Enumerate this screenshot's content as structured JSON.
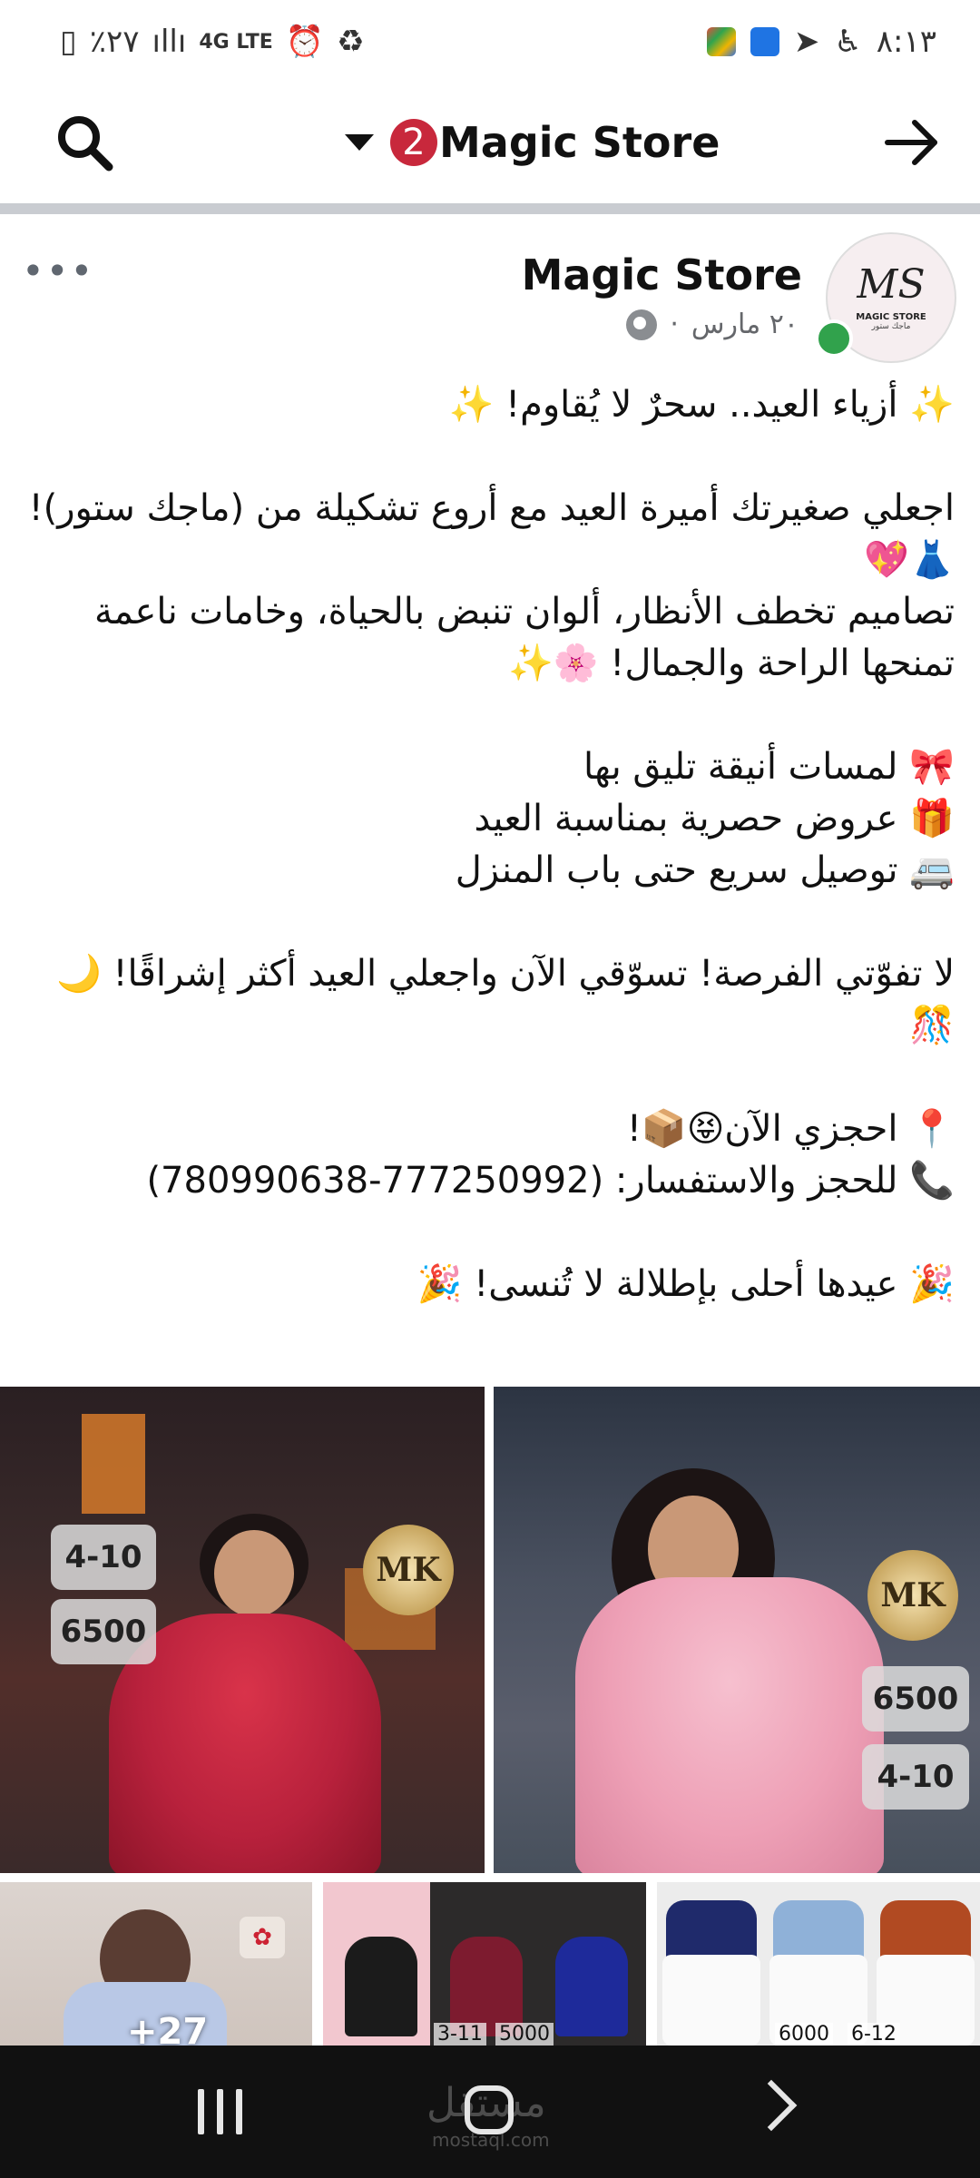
{
  "status_bar": {
    "time": "٨:١٣",
    "battery": "٪٢٧",
    "network": "4G LTE"
  },
  "app_bar": {
    "title": "Magic Store",
    "badge_count": "2"
  },
  "post": {
    "author": "Magic Store",
    "date": "٢٠ مارس",
    "avatar": {
      "monogram": "MS",
      "line1": "MAGIC STORE",
      "line2": "ماجك ستور"
    },
    "text": "✨ أزياء العيد.. سحرٌ لا يُقاوم! ✨\n\nاجعلي صغيرتك أميرة العيد مع أروع تشكيلة من (ماجك ستور)! 👗💖\nتصاميم تخطف الأنظار، ألوان تنبض بالحياة، وخامات ناعمة تمنحها الراحة والجمال! 🌸✨\n\n🎀 لمسات أنيقة تليق بها\n🎁 عروض حصرية بمناسبة العيد\n🚐 توصيل سريع حتى باب المنزل\n\nلا تفوّتي الفرصة! تسوّقي الآن واجعلي العيد أكثر إشراقًا! 🌙🎊\n\n📍 احجزي الآن😝📦!\n📞 للحجز والاستفسار: (777250992-780990638)\n\n🎉 عيدها أحلى بإطلالة لا تُنسى! 🎉",
    "photos": [
      {
        "logo": "MK",
        "size": "4-10",
        "price": "6500"
      },
      {
        "logo": "MK",
        "price": "6500",
        "size": "4-10"
      }
    ],
    "thumbs": [
      {
        "more_count": "+27"
      },
      {
        "label_a": "3-11",
        "label_b": "5000"
      },
      {
        "label_a": "6000",
        "label_b": "6-12"
      }
    ]
  },
  "nav": {
    "watermark": "مستقل",
    "watermark_sub": "mostaql.com"
  },
  "colors": {
    "badge": "#c8283c",
    "online": "#31a24c",
    "divider": "#c9ccd1"
  }
}
